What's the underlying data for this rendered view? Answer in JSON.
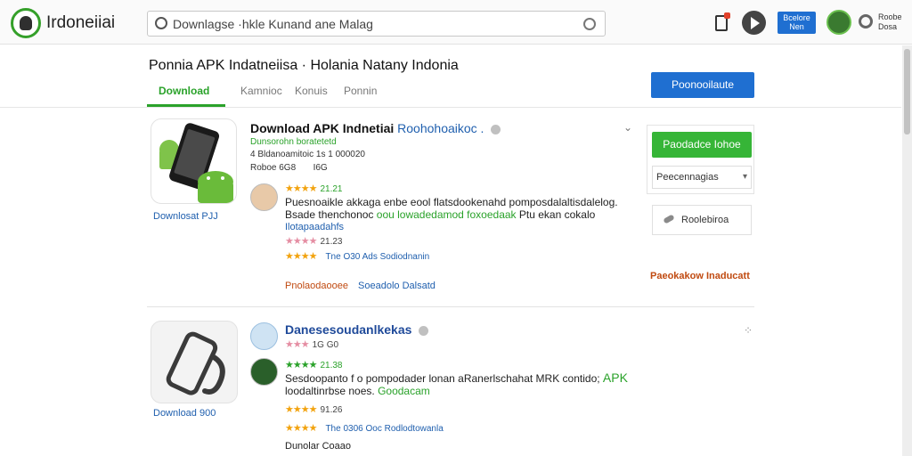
{
  "app": {
    "brand": "Irdoneiiai"
  },
  "search": {
    "value": "Downlagse ·hkle Kunand ane Malag",
    "placeholder": "Downlagse ·hkle Kunand ane Malag"
  },
  "topbar": {
    "button_label": "Bcelore Nen",
    "user_text": "Roobe Dosa"
  },
  "header": {
    "title": "Ponnia APK Indatneiisa · Holania  Natany  Indonia",
    "tabs": [
      {
        "label": "Download",
        "active": true
      },
      {
        "label": "Kamnioc",
        "active": false
      },
      {
        "label": "Konuis",
        "active": false
      },
      {
        "label": "Ponnin",
        "active": false
      }
    ],
    "primary_button": "Poonooilaute"
  },
  "card1": {
    "title": "Download APK Indnetiai",
    "title_link": "Roohohoaikoc .",
    "download_link": "Downlosat PJJ",
    "meta": [
      "Dunsorohn boratetetd",
      "4 Bldanoamitoic 1s 1 000020",
      "Roboe 6G8       I6G"
    ],
    "review1_rating": "21.21",
    "review1_text_a": "Puesnoaikle akkaga enbe eool flatsdookenahd pomposdalaltisdalelog.",
    "review1_text_b1": "Bsade thenchonoc",
    "review1_text_b2": "oou lowadedamod foxoedaak",
    "review1_text_b3": "Ptu ekan cokalo",
    "review1_text_c": "Ilotapaadahfs",
    "rating2": "21.23",
    "rating3_link": "Tne O30 Ads  Sodiodnanin",
    "footer_label": "Pnolaodaooee",
    "footer_link": "Soeadolo Dalsatd",
    "install_button": "Paodadce Iohoe",
    "select_value": "Peecennagias",
    "share_label": "Roolebiroa",
    "report_label": "Paeokakow Inaducatt"
  },
  "card2": {
    "title": "Danesesoudanlkekas",
    "download_link": "Download 900",
    "rating1": "1G G0",
    "rating2": "21.38",
    "review_text_a1": "Sesdoopanto f o pompodader lonan aRanerlschahat",
    "review_text_a2": "MRK contido;",
    "review_text_a3": "APK",
    "review_text_b1": "loodaltinrbse noes.",
    "review_text_b2": "Goodacam",
    "rating3": "91.26",
    "rating4_link": "The 0306 Ooc  Rodlodtowanla",
    "footer_text": "Dunolar Coaao"
  },
  "colors": {
    "accent_green": "#2aa22a",
    "accent_blue": "#1f6fd1",
    "link_blue": "#1f5fae",
    "warning_orange": "#c04a10",
    "star_gold": "#f2a30f"
  },
  "icons": [
    "android-logo-icon",
    "search-icon",
    "mic-icon",
    "document-icon",
    "play-icon",
    "user-icon",
    "info-icon",
    "chevron-down-icon",
    "share-icon",
    "expand-icon"
  ]
}
